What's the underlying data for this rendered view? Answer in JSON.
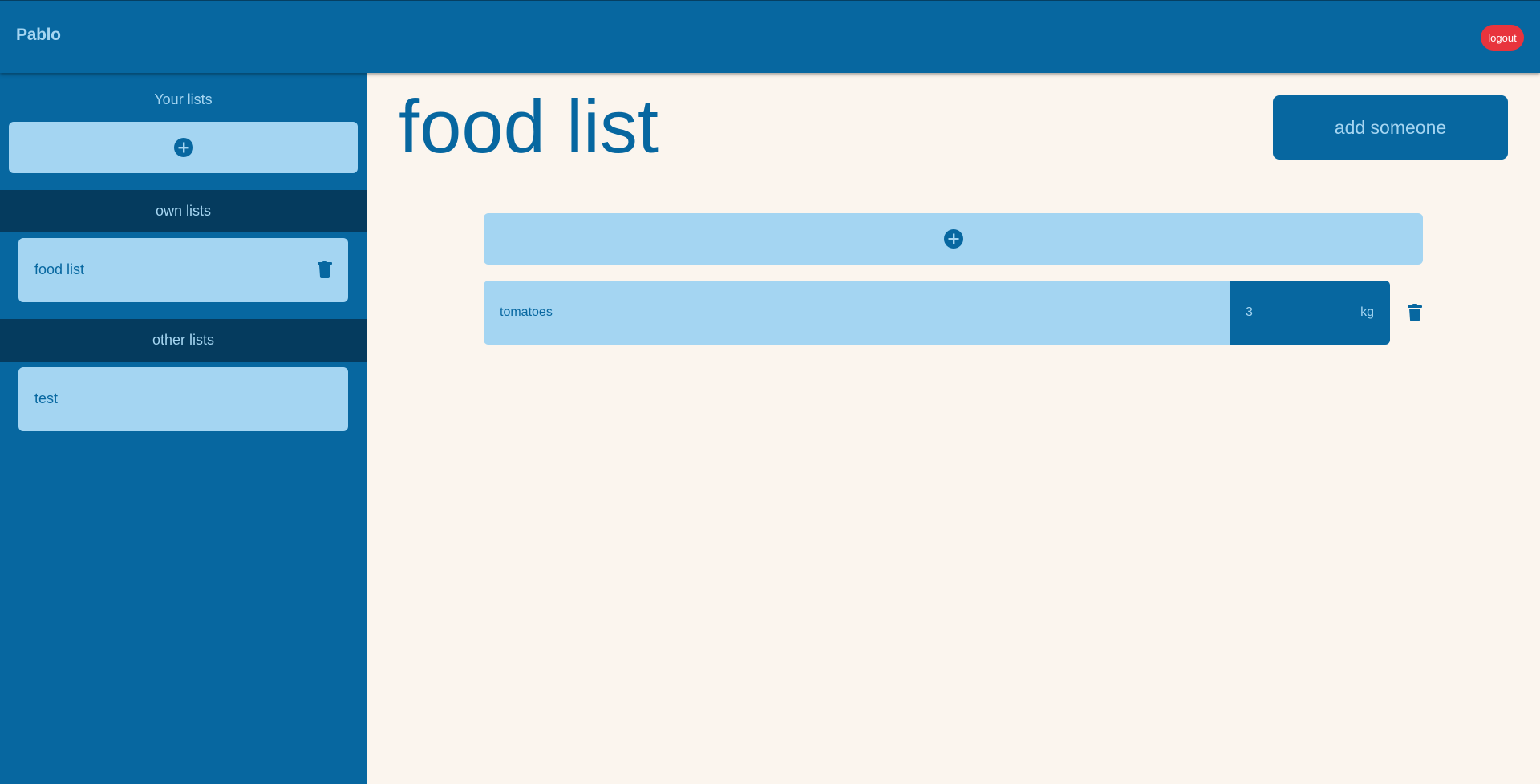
{
  "header": {
    "username": "Pablo",
    "logout_label": "logout"
  },
  "sidebar": {
    "title": "Your lists",
    "add_icon": "plus-circle-icon",
    "own_lists": {
      "heading": "own lists",
      "items": [
        {
          "label": "food list",
          "icon": "trash-icon"
        }
      ]
    },
    "other_lists": {
      "heading": "other lists",
      "items": [
        {
          "label": "test"
        }
      ]
    }
  },
  "main": {
    "title": "food list",
    "add_someone_label": "add someone",
    "add_item_icon": "plus-circle-icon",
    "items": [
      {
        "name": "tomatoes",
        "quantity": "3",
        "unit": "kg",
        "icon": "trash-icon"
      }
    ]
  },
  "colors": {
    "primary": "#0767a0",
    "light": "#a4d5f2",
    "dark_section": "#053b5e",
    "background": "#fbf5ee",
    "logout": "#e8343d"
  }
}
